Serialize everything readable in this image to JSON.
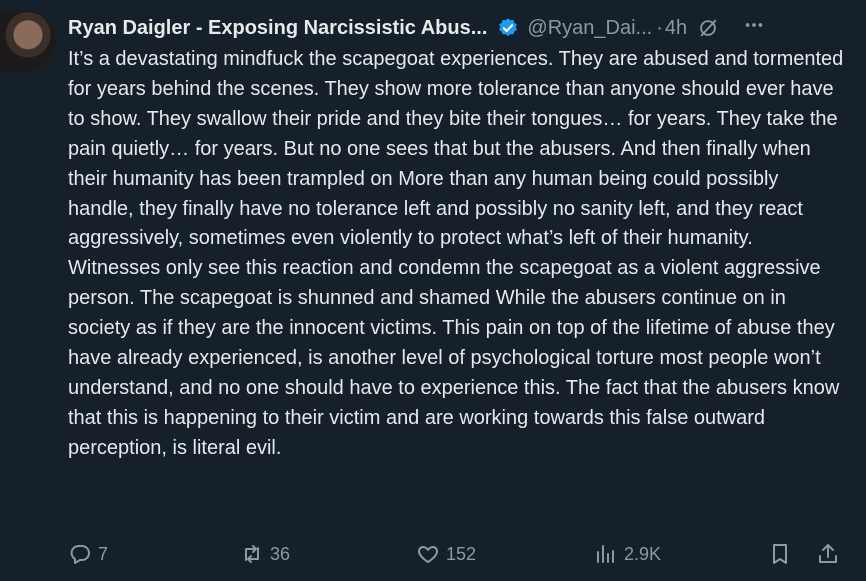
{
  "author": {
    "name": "Ryan Daigler - Exposing Narcissistic Abus...",
    "handle": "@Ryan_Dai...",
    "time": "4h",
    "separator": "·"
  },
  "post": {
    "text": "It’s a devastating mindfuck the scapegoat experiences. They are abused and tormented for years behind the scenes. They show more tolerance than anyone should ever have to show. They swallow their pride and they bite their tongues… for years. They take the pain quietly… for years. But no one sees that but the abusers. And then finally when their humanity has been trampled on More than any human being could possibly handle, they finally have no tolerance left and possibly no sanity left, and they react aggressively, sometimes even violently to protect what’s left of their humanity. Witnesses only see this reaction and condemn the scapegoat as a violent aggressive person. The scapegoat is shunned and shamed While the abusers continue on in society as if they are the innocent victims. This pain on top of the lifetime of abuse they have already experienced, is another level of psychological torture most people won’t understand, and no one should have to experience this. The fact that the abusers know that this is happening to their victim and are working towards this false outward perception, is literal evil."
  },
  "stats": {
    "replies": "7",
    "reposts": "36",
    "likes": "152",
    "views": "2.9K"
  },
  "icons": {
    "verified": "verified-badge-icon",
    "grok": "grok-icon",
    "more": "more-icon",
    "reply": "reply-icon",
    "repost": "repost-icon",
    "like": "like-icon",
    "views": "views-icon",
    "bookmark": "bookmark-icon",
    "share": "share-icon"
  },
  "colors": {
    "background": "#15202b",
    "text": "#e7e9ea",
    "muted": "#8b98a5",
    "verified": "#1d9bf0"
  }
}
